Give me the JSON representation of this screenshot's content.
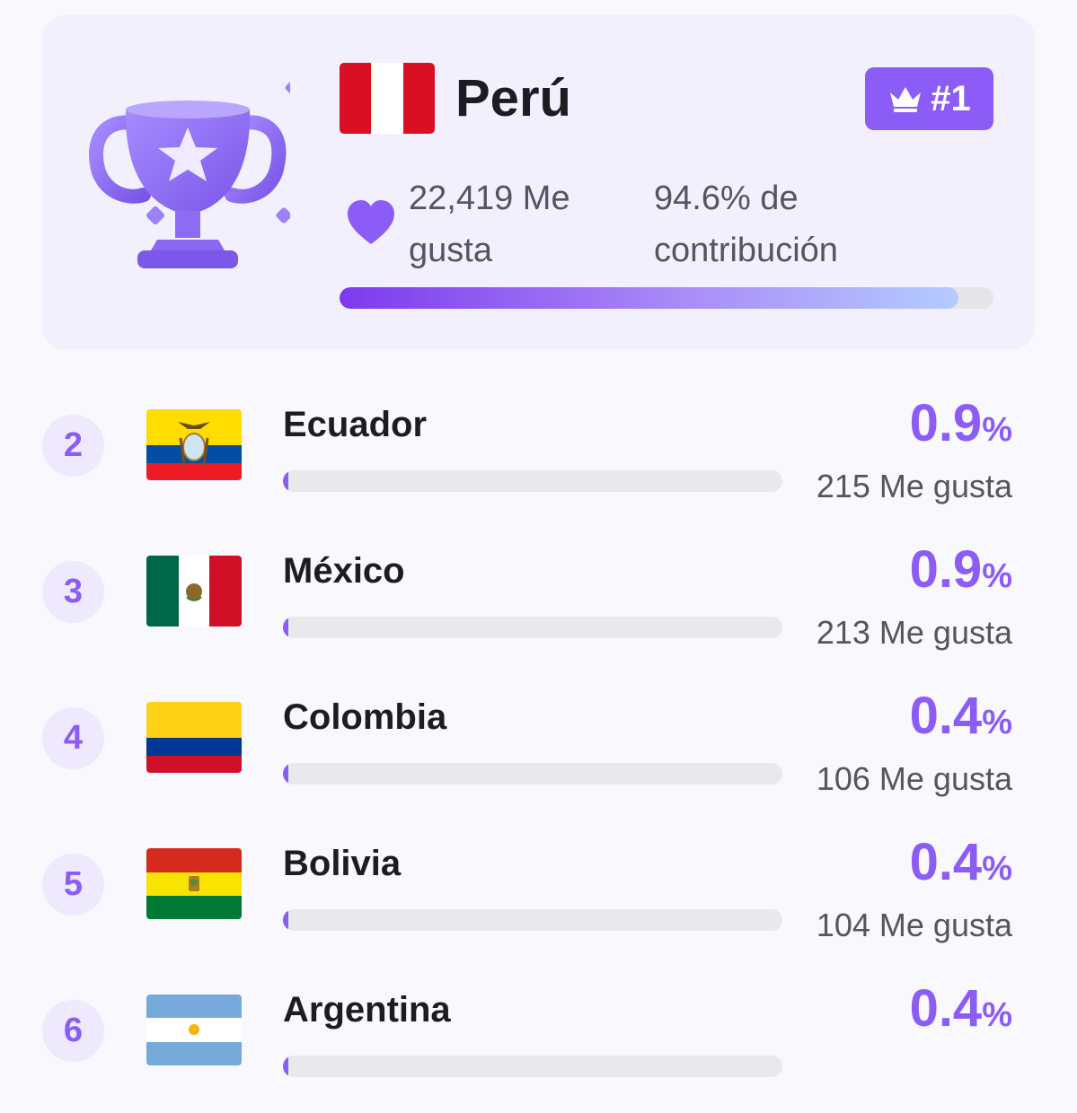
{
  "top": {
    "rank_label": "#1",
    "country": "Perú",
    "likes": "22,419 Me gusta",
    "contribution": "94.6% de contribución",
    "progress": 0.946,
    "flag_colors": [
      "#d91023",
      "#ffffff",
      "#d91023"
    ]
  },
  "icons": [
    "trophy-icon",
    "crown-icon",
    "heart-icon"
  ],
  "accent": "#8b5cf6",
  "rows": [
    {
      "rank": "2",
      "country": "Ecuador",
      "percent": "0.9",
      "percent_symbol": "%",
      "likes": "215 Me gusta",
      "progress": 0.009
    },
    {
      "rank": "3",
      "country": "México",
      "percent": "0.9",
      "percent_symbol": "%",
      "likes": "213 Me gusta",
      "progress": 0.009
    },
    {
      "rank": "4",
      "country": "Colombia",
      "percent": "0.4",
      "percent_symbol": "%",
      "likes": "106 Me gusta",
      "progress": 0.004
    },
    {
      "rank": "5",
      "country": "Bolivia",
      "percent": "0.4",
      "percent_symbol": "%",
      "likes": "104 Me gusta",
      "progress": 0.004
    },
    {
      "rank": "6",
      "country": "Argentina",
      "percent": "0.4",
      "percent_symbol": "%",
      "likes": "",
      "progress": 0.004
    }
  ]
}
